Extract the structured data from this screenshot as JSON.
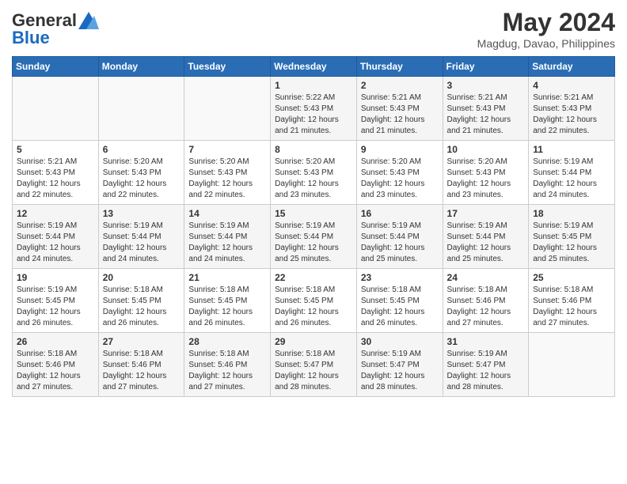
{
  "header": {
    "logo_line1": "General",
    "logo_line2": "Blue",
    "month_year": "May 2024",
    "location": "Magdug, Davao, Philippines"
  },
  "days_of_week": [
    "Sunday",
    "Monday",
    "Tuesday",
    "Wednesday",
    "Thursday",
    "Friday",
    "Saturday"
  ],
  "weeks": [
    [
      {
        "day": "",
        "sunrise": "",
        "sunset": "",
        "daylight": ""
      },
      {
        "day": "",
        "sunrise": "",
        "sunset": "",
        "daylight": ""
      },
      {
        "day": "",
        "sunrise": "",
        "sunset": "",
        "daylight": ""
      },
      {
        "day": "1",
        "sunrise": "Sunrise: 5:22 AM",
        "sunset": "Sunset: 5:43 PM",
        "daylight": "Daylight: 12 hours and 21 minutes."
      },
      {
        "day": "2",
        "sunrise": "Sunrise: 5:21 AM",
        "sunset": "Sunset: 5:43 PM",
        "daylight": "Daylight: 12 hours and 21 minutes."
      },
      {
        "day": "3",
        "sunrise": "Sunrise: 5:21 AM",
        "sunset": "Sunset: 5:43 PM",
        "daylight": "Daylight: 12 hours and 21 minutes."
      },
      {
        "day": "4",
        "sunrise": "Sunrise: 5:21 AM",
        "sunset": "Sunset: 5:43 PM",
        "daylight": "Daylight: 12 hours and 22 minutes."
      }
    ],
    [
      {
        "day": "5",
        "sunrise": "Sunrise: 5:21 AM",
        "sunset": "Sunset: 5:43 PM",
        "daylight": "Daylight: 12 hours and 22 minutes."
      },
      {
        "day": "6",
        "sunrise": "Sunrise: 5:20 AM",
        "sunset": "Sunset: 5:43 PM",
        "daylight": "Daylight: 12 hours and 22 minutes."
      },
      {
        "day": "7",
        "sunrise": "Sunrise: 5:20 AM",
        "sunset": "Sunset: 5:43 PM",
        "daylight": "Daylight: 12 hours and 22 minutes."
      },
      {
        "day": "8",
        "sunrise": "Sunrise: 5:20 AM",
        "sunset": "Sunset: 5:43 PM",
        "daylight": "Daylight: 12 hours and 23 minutes."
      },
      {
        "day": "9",
        "sunrise": "Sunrise: 5:20 AM",
        "sunset": "Sunset: 5:43 PM",
        "daylight": "Daylight: 12 hours and 23 minutes."
      },
      {
        "day": "10",
        "sunrise": "Sunrise: 5:20 AM",
        "sunset": "Sunset: 5:43 PM",
        "daylight": "Daylight: 12 hours and 23 minutes."
      },
      {
        "day": "11",
        "sunrise": "Sunrise: 5:19 AM",
        "sunset": "Sunset: 5:44 PM",
        "daylight": "Daylight: 12 hours and 24 minutes."
      }
    ],
    [
      {
        "day": "12",
        "sunrise": "Sunrise: 5:19 AM",
        "sunset": "Sunset: 5:44 PM",
        "daylight": "Daylight: 12 hours and 24 minutes."
      },
      {
        "day": "13",
        "sunrise": "Sunrise: 5:19 AM",
        "sunset": "Sunset: 5:44 PM",
        "daylight": "Daylight: 12 hours and 24 minutes."
      },
      {
        "day": "14",
        "sunrise": "Sunrise: 5:19 AM",
        "sunset": "Sunset: 5:44 PM",
        "daylight": "Daylight: 12 hours and 24 minutes."
      },
      {
        "day": "15",
        "sunrise": "Sunrise: 5:19 AM",
        "sunset": "Sunset: 5:44 PM",
        "daylight": "Daylight: 12 hours and 25 minutes."
      },
      {
        "day": "16",
        "sunrise": "Sunrise: 5:19 AM",
        "sunset": "Sunset: 5:44 PM",
        "daylight": "Daylight: 12 hours and 25 minutes."
      },
      {
        "day": "17",
        "sunrise": "Sunrise: 5:19 AM",
        "sunset": "Sunset: 5:44 PM",
        "daylight": "Daylight: 12 hours and 25 minutes."
      },
      {
        "day": "18",
        "sunrise": "Sunrise: 5:19 AM",
        "sunset": "Sunset: 5:45 PM",
        "daylight": "Daylight: 12 hours and 25 minutes."
      }
    ],
    [
      {
        "day": "19",
        "sunrise": "Sunrise: 5:19 AM",
        "sunset": "Sunset: 5:45 PM",
        "daylight": "Daylight: 12 hours and 26 minutes."
      },
      {
        "day": "20",
        "sunrise": "Sunrise: 5:18 AM",
        "sunset": "Sunset: 5:45 PM",
        "daylight": "Daylight: 12 hours and 26 minutes."
      },
      {
        "day": "21",
        "sunrise": "Sunrise: 5:18 AM",
        "sunset": "Sunset: 5:45 PM",
        "daylight": "Daylight: 12 hours and 26 minutes."
      },
      {
        "day": "22",
        "sunrise": "Sunrise: 5:18 AM",
        "sunset": "Sunset: 5:45 PM",
        "daylight": "Daylight: 12 hours and 26 minutes."
      },
      {
        "day": "23",
        "sunrise": "Sunrise: 5:18 AM",
        "sunset": "Sunset: 5:45 PM",
        "daylight": "Daylight: 12 hours and 26 minutes."
      },
      {
        "day": "24",
        "sunrise": "Sunrise: 5:18 AM",
        "sunset": "Sunset: 5:46 PM",
        "daylight": "Daylight: 12 hours and 27 minutes."
      },
      {
        "day": "25",
        "sunrise": "Sunrise: 5:18 AM",
        "sunset": "Sunset: 5:46 PM",
        "daylight": "Daylight: 12 hours and 27 minutes."
      }
    ],
    [
      {
        "day": "26",
        "sunrise": "Sunrise: 5:18 AM",
        "sunset": "Sunset: 5:46 PM",
        "daylight": "Daylight: 12 hours and 27 minutes."
      },
      {
        "day": "27",
        "sunrise": "Sunrise: 5:18 AM",
        "sunset": "Sunset: 5:46 PM",
        "daylight": "Daylight: 12 hours and 27 minutes."
      },
      {
        "day": "28",
        "sunrise": "Sunrise: 5:18 AM",
        "sunset": "Sunset: 5:46 PM",
        "daylight": "Daylight: 12 hours and 27 minutes."
      },
      {
        "day": "29",
        "sunrise": "Sunrise: 5:18 AM",
        "sunset": "Sunset: 5:47 PM",
        "daylight": "Daylight: 12 hours and 28 minutes."
      },
      {
        "day": "30",
        "sunrise": "Sunrise: 5:19 AM",
        "sunset": "Sunset: 5:47 PM",
        "daylight": "Daylight: 12 hours and 28 minutes."
      },
      {
        "day": "31",
        "sunrise": "Sunrise: 5:19 AM",
        "sunset": "Sunset: 5:47 PM",
        "daylight": "Daylight: 12 hours and 28 minutes."
      },
      {
        "day": "",
        "sunrise": "",
        "sunset": "",
        "daylight": ""
      }
    ]
  ]
}
